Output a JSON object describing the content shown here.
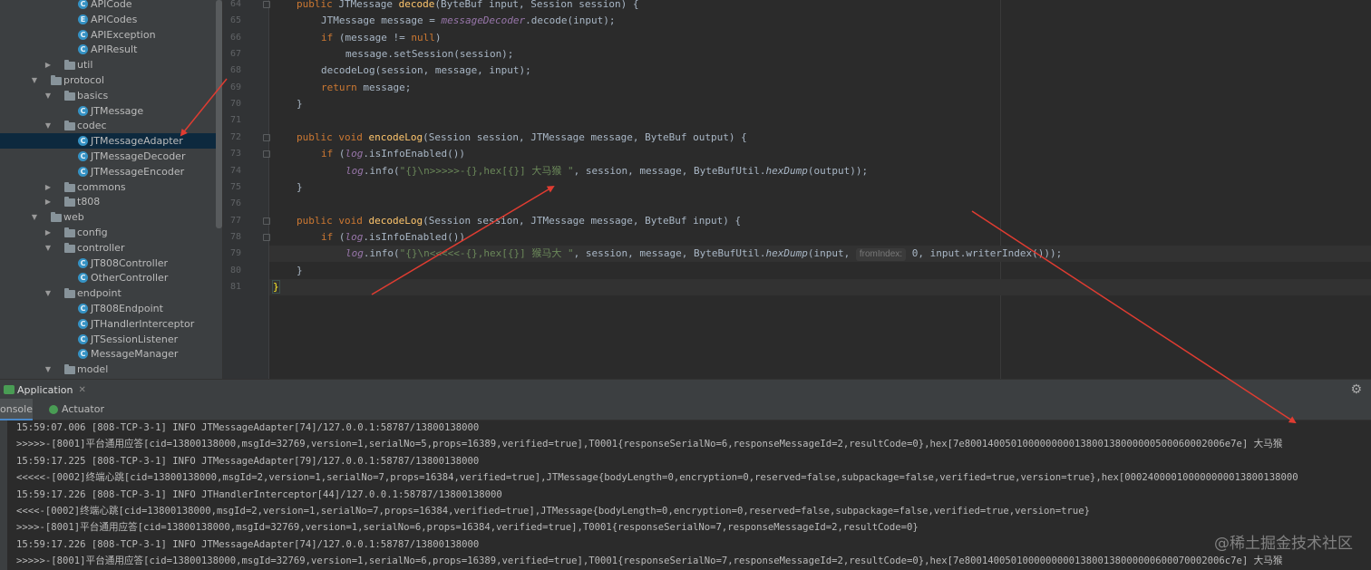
{
  "project_tree": {
    "items": [
      {
        "label": "APICode",
        "kind": "cls",
        "depth": 3,
        "expanded": null
      },
      {
        "label": "APICodes",
        "kind": "enm",
        "depth": 3,
        "expanded": null
      },
      {
        "label": "APIException",
        "kind": "cls",
        "depth": 3,
        "expanded": null
      },
      {
        "label": "APIResult",
        "kind": "cls",
        "depth": 3,
        "expanded": null
      },
      {
        "label": "util",
        "kind": "fld",
        "depth": 2,
        "expanded": false
      },
      {
        "label": "protocol",
        "kind": "fld",
        "depth": 1,
        "expanded": true
      },
      {
        "label": "basics",
        "kind": "fld",
        "depth": 2,
        "expanded": true
      },
      {
        "label": "JTMessage",
        "kind": "cls",
        "depth": 3,
        "expanded": null
      },
      {
        "label": "codec",
        "kind": "fld",
        "depth": 2,
        "expanded": true
      },
      {
        "label": "JTMessageAdapter",
        "kind": "cls",
        "depth": 3,
        "expanded": null,
        "selected": true
      },
      {
        "label": "JTMessageDecoder",
        "kind": "cls",
        "depth": 3,
        "expanded": null
      },
      {
        "label": "JTMessageEncoder",
        "kind": "cls",
        "depth": 3,
        "expanded": null
      },
      {
        "label": "commons",
        "kind": "fld",
        "depth": 2,
        "expanded": false
      },
      {
        "label": "t808",
        "kind": "fld",
        "depth": 2,
        "expanded": false
      },
      {
        "label": "web",
        "kind": "fld",
        "depth": 1,
        "expanded": true
      },
      {
        "label": "config",
        "kind": "fld",
        "depth": 2,
        "expanded": false
      },
      {
        "label": "controller",
        "kind": "fld",
        "depth": 2,
        "expanded": true
      },
      {
        "label": "JT808Controller",
        "kind": "cls",
        "depth": 3,
        "expanded": null
      },
      {
        "label": "OtherController",
        "kind": "cls",
        "depth": 3,
        "expanded": null
      },
      {
        "label": "endpoint",
        "kind": "fld",
        "depth": 2,
        "expanded": true
      },
      {
        "label": "JT808Endpoint",
        "kind": "cls",
        "depth": 3,
        "expanded": null
      },
      {
        "label": "JTHandlerInterceptor",
        "kind": "cls",
        "depth": 3,
        "expanded": null
      },
      {
        "label": "JTSessionListener",
        "kind": "cls",
        "depth": 3,
        "expanded": null
      },
      {
        "label": "MessageManager",
        "kind": "cls",
        "depth": 3,
        "expanded": null
      },
      {
        "label": "model",
        "kind": "fld",
        "depth": 2,
        "expanded": true
      }
    ]
  },
  "editor": {
    "line_numbers": [
      "64",
      "65",
      "66",
      "67",
      "68",
      "69",
      "70",
      "71",
      "72",
      "73",
      "74",
      "75",
      "76",
      "77",
      "78",
      "79",
      "80",
      "81"
    ],
    "lines": [
      {
        "indent": 1,
        "tokens": [
          [
            "kw",
            "public "
          ],
          [
            "",
            "JTMessage "
          ],
          [
            "fn",
            "decode"
          ],
          [
            "",
            "(ByteBuf input, Session session) {"
          ]
        ]
      },
      {
        "indent": 2,
        "tokens": [
          [
            "",
            "JTMessage message = "
          ],
          [
            "fd",
            "messageDecoder"
          ],
          [
            "",
            ".decode(input);"
          ]
        ]
      },
      {
        "indent": 2,
        "tokens": [
          [
            "kw",
            "if "
          ],
          [
            "",
            "(message != "
          ],
          [
            "kw",
            "null"
          ],
          [
            "",
            ")"
          ]
        ]
      },
      {
        "indent": 3,
        "tokens": [
          [
            "",
            "message.setSession(session);"
          ]
        ]
      },
      {
        "indent": 2,
        "tokens": [
          [
            "",
            "decodeLog(session, message, input);"
          ]
        ]
      },
      {
        "indent": 2,
        "tokens": [
          [
            "kw",
            "return "
          ],
          [
            "",
            "message;"
          ]
        ]
      },
      {
        "indent": 1,
        "tokens": [
          [
            "",
            "}"
          ]
        ]
      },
      {
        "indent": 0,
        "tokens": []
      },
      {
        "indent": 1,
        "tokens": [
          [
            "kw",
            "public void "
          ],
          [
            "fn",
            "encodeLog"
          ],
          [
            "",
            "(Session session, JTMessage message, ByteBuf output) {"
          ]
        ]
      },
      {
        "indent": 2,
        "tokens": [
          [
            "kw",
            "if "
          ],
          [
            "",
            "("
          ],
          [
            "fd",
            "log"
          ],
          [
            "",
            ".isInfoEnabled())"
          ]
        ]
      },
      {
        "indent": 3,
        "tokens": [
          [
            "fd",
            "log"
          ],
          [
            "",
            ".info("
          ],
          [
            "str",
            "\"{}\\n>>>>>-{},hex[{}] 大马猴 \""
          ],
          [
            "",
            ", session, message, ByteBufUtil."
          ],
          [
            "it",
            "hexDump"
          ],
          [
            "",
            "(output));"
          ]
        ]
      },
      {
        "indent": 1,
        "tokens": [
          [
            "",
            "}"
          ]
        ]
      },
      {
        "indent": 0,
        "tokens": []
      },
      {
        "indent": 1,
        "tokens": [
          [
            "kw",
            "public void "
          ],
          [
            "fn",
            "decodeLog"
          ],
          [
            "",
            "(Session session, JTMessage message, ByteBuf input) {"
          ]
        ]
      },
      {
        "indent": 2,
        "tokens": [
          [
            "kw",
            "if "
          ],
          [
            "",
            "("
          ],
          [
            "fd",
            "log"
          ],
          [
            "",
            ".isInfoEnabled())"
          ]
        ]
      },
      {
        "indent": 3,
        "tokens": [
          [
            "fd",
            "log"
          ],
          [
            "",
            ".info("
          ],
          [
            "str",
            "\"{}\\n<<<<<-{},hex[{}] 猴马大 \""
          ],
          [
            "",
            ", session, message, ByteBufUtil."
          ],
          [
            "it",
            "hexDump"
          ],
          [
            "",
            "(input, "
          ],
          [
            "hint",
            "fromIndex:"
          ],
          [
            "",
            " 0, input.writerIndex()));"
          ]
        ]
      },
      {
        "indent": 1,
        "tokens": [
          [
            "",
            "}"
          ]
        ]
      },
      {
        "indent": 0,
        "tokens": [
          [
            "brk",
            "}"
          ]
        ]
      }
    ]
  },
  "run_panel": {
    "tab_label": "Application",
    "console_tab": "onsole",
    "actuator_tab": "Actuator"
  },
  "console": {
    "lines": [
      "15:59:07.006 [808-TCP-3-1] INFO JTMessageAdapter[74]/127.0.0.1:58787/13800138000",
      ">>>>>-[8001]平台通用应答[cid=13800138000,msgId=32769,version=1,serialNo=5,props=16389,verified=true],T0001{responseSerialNo=6,responseMessageId=2,resultCode=0},hex[7e800140050100000000013800138000000500060002006e7e] 大马猴",
      "15:59:17.225 [808-TCP-3-1] INFO JTMessageAdapter[79]/127.0.0.1:58787/13800138000",
      "<<<<<-[0002]终端心跳[cid=13800138000,msgId=2,version=1,serialNo=7,props=16384,verified=true],JTMessage{bodyLength=0,encryption=0,reserved=false,subpackage=false,verified=true,version=true},hex[000240000100000000013800138000",
      "15:59:17.226 [808-TCP-3-1] INFO JTHandlerInterceptor[44]/127.0.0.1:58787/13800138000",
      "<<<<-[0002]终端心跳[cid=13800138000,msgId=2,version=1,serialNo=7,props=16384,verified=true],JTMessage{bodyLength=0,encryption=0,reserved=false,subpackage=false,verified=true,version=true}",
      ">>>>-[8001]平台通用应答[cid=13800138000,msgId=32769,version=1,serialNo=6,props=16384,verified=true],T0001{responseSerialNo=7,responseMessageId=2,resultCode=0}",
      "15:59:17.226 [808-TCP-3-1] INFO JTMessageAdapter[74]/127.0.0.1:58787/13800138000",
      ">>>>>-[8001]平台通用应答[cid=13800138000,msgId=32769,version=1,serialNo=6,props=16389,verified=true],T0001{responseSerialNo=7,responseMessageId=2,resultCode=0},hex[7e800140050100000000013800138000000600070002006c7e] 大马猴"
    ]
  },
  "watermark": "@稀土掘金技术社区",
  "colors": {
    "annotation_arrow": "#e03c31",
    "selection": "#0d293e",
    "accent": "#4a88c7"
  }
}
